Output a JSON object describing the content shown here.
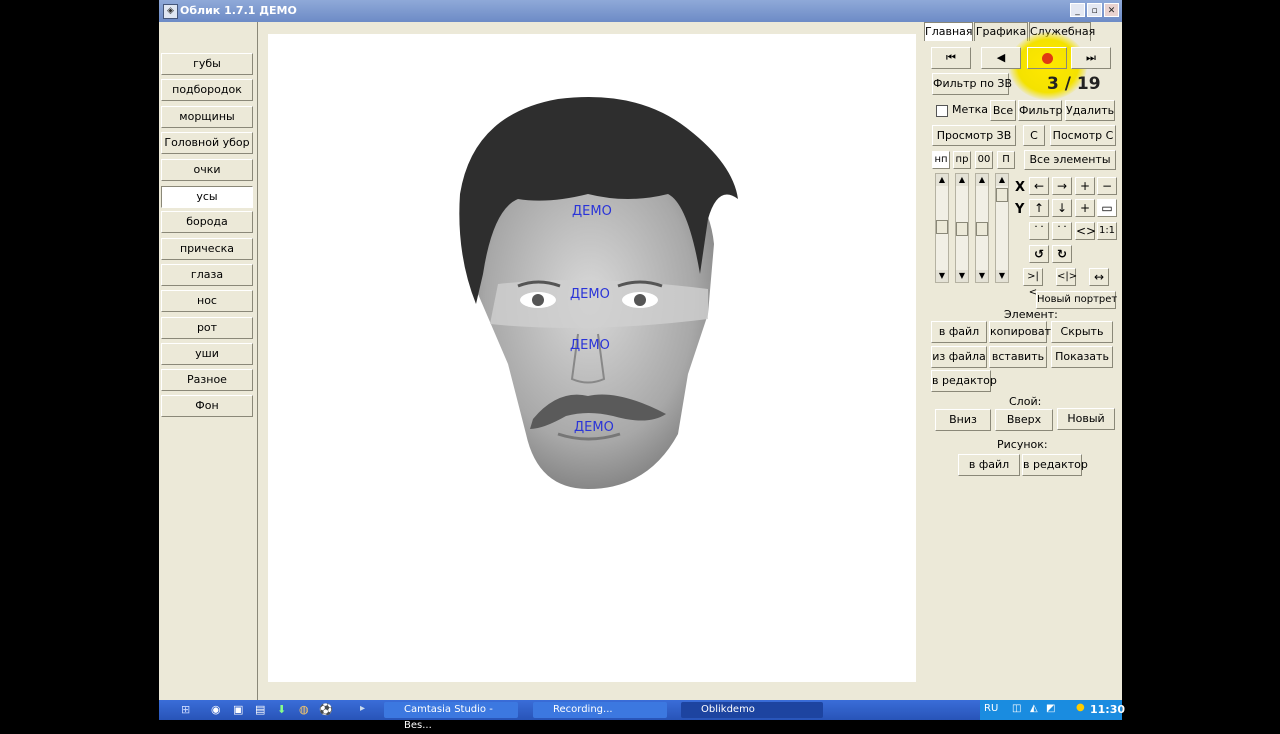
{
  "window": {
    "title": "Облик 1.7.1 ДЕМО"
  },
  "left_panel": {
    "items": [
      "губы",
      "подбородок",
      "морщины",
      "Головной убор",
      "очки",
      "усы",
      "борода",
      "прическа",
      "глаза",
      "нос",
      "рот",
      "уши",
      "Разное",
      "Фон"
    ],
    "selected": "усы"
  },
  "canvas": {
    "watermark": "ДЕМО"
  },
  "right_panel": {
    "tabs": [
      "Главная",
      "Графика",
      "Служебная"
    ],
    "active_tab": "Главная",
    "filter_button": "Фильтр по ЗВ",
    "counter": "3 / 19",
    "mark_label": "Метка",
    "all_button": "Все",
    "filter2_button": "Фильтр",
    "delete_button": "Удалить",
    "view_zv_button": "Просмотр ЗВ",
    "c_button": "С",
    "view_c_button": "Посмотр С",
    "mini_toggles": [
      "нп",
      "пр",
      "00",
      "П"
    ],
    "all_elements_button": "Все элементы",
    "x_label": "X",
    "y_label": "Y",
    "ratio_button": "1:1",
    "new_portrait_button": "Новый портрет",
    "element_label": "Элемент:",
    "to_file_button": "в файл",
    "copy_button": "копировать",
    "hide_button": "Скрыть",
    "from_file_button": "из файла",
    "paste_button": "вставить",
    "show_button": "Показать",
    "to_editor_button": "в редактор",
    "layer_label": "Слой:",
    "down_button": "Вниз",
    "up_button": "Вверх",
    "new_button": "Новый",
    "picture_label": "Рисунок:",
    "pic_to_file_button": "в файл",
    "pic_to_editor_button": "в редактор"
  },
  "taskbar": {
    "tasks": [
      "Camtasia Studio - Bes...",
      "Recording...",
      "Oblikdemo"
    ],
    "language": "RU",
    "clock": "11:30"
  },
  "colors": {
    "title_bar": "#6d8bc6",
    "window_bg": "#ece9d8",
    "watermark": "#2a34d8",
    "taskbar": "#2854b8",
    "highlight": "#f5e400"
  }
}
